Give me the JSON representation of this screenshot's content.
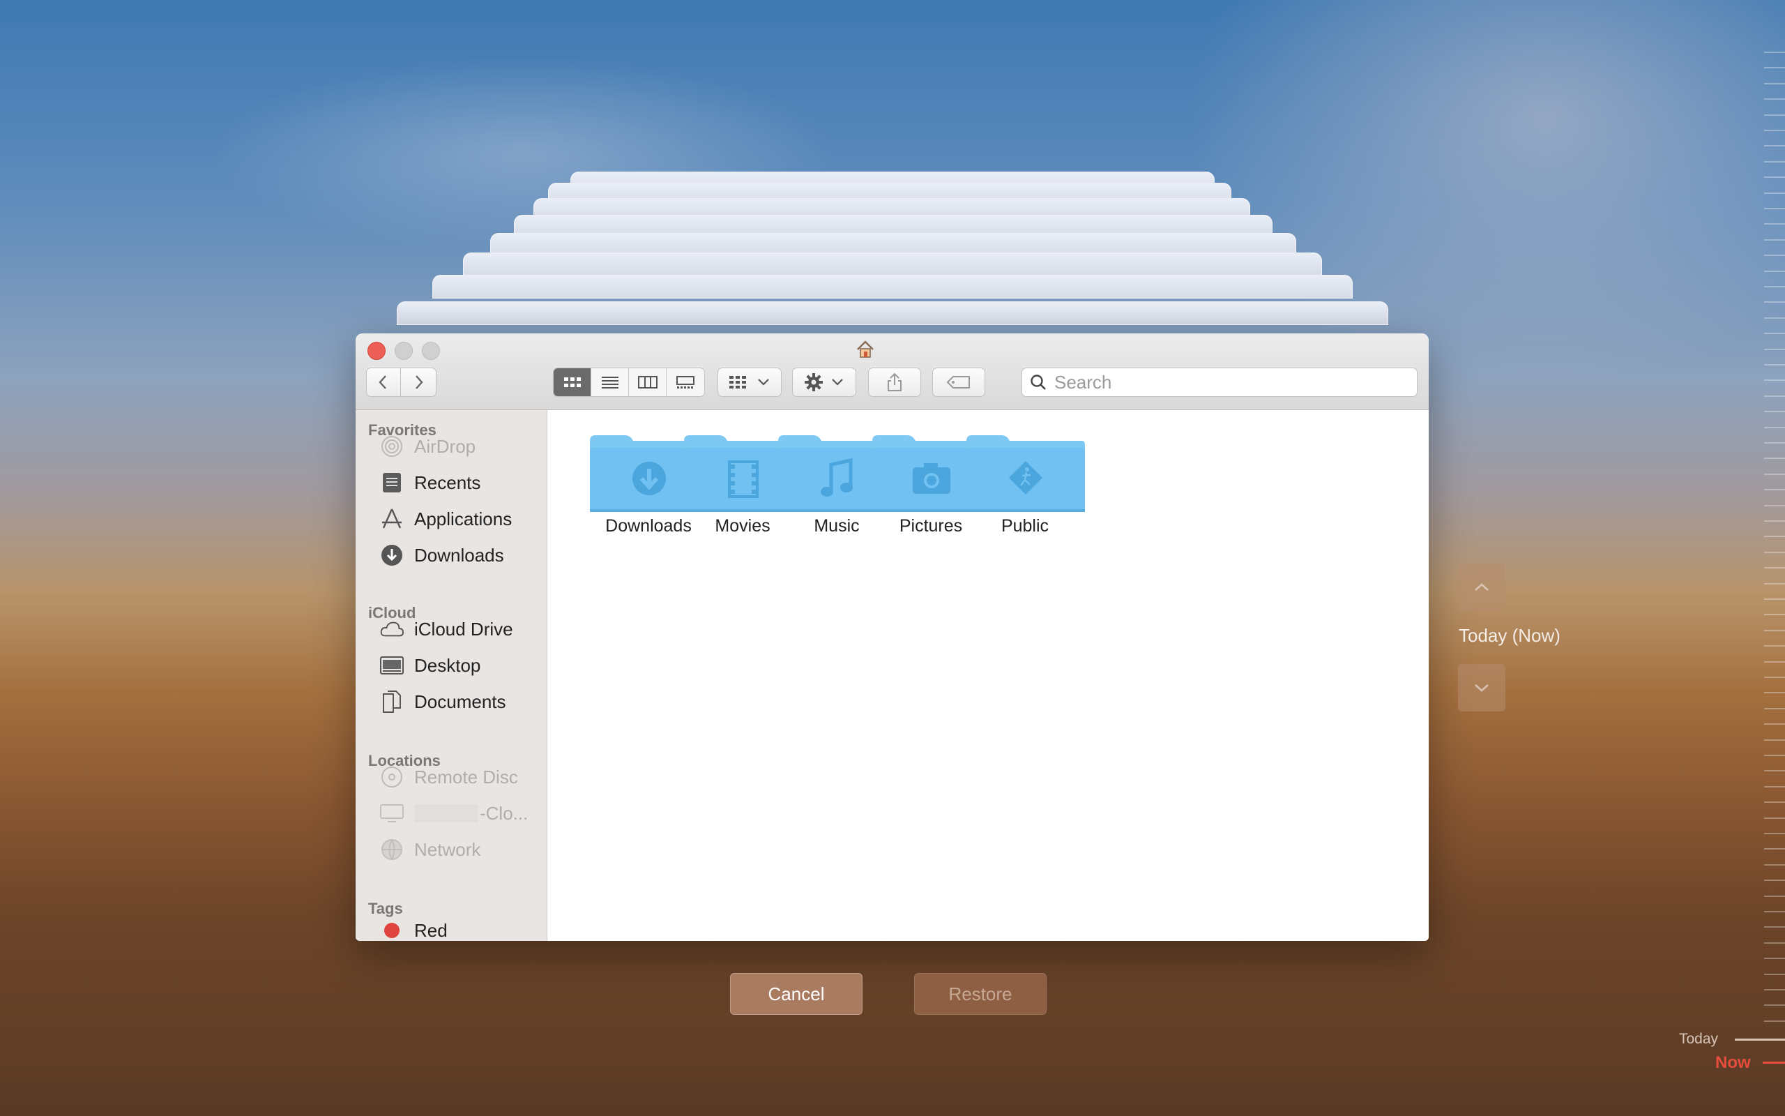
{
  "window": {
    "title_icon": "house-icon"
  },
  "toolbar": {
    "back_icon": "chevron-left-icon",
    "forward_icon": "chevron-right-icon",
    "view_modes": [
      "icon-view-icon",
      "list-view-icon",
      "column-view-icon",
      "gallery-view-icon"
    ],
    "active_view": "icon-view-icon",
    "group_icon": "group-by-icon",
    "action_icon": "gear-icon",
    "share_icon": "share-icon",
    "tag_icon": "tag-icon",
    "search_placeholder": "Search"
  },
  "sidebar": {
    "favorites_title": "Favorites",
    "favorites": [
      {
        "label": "AirDrop",
        "icon": "airdrop-icon",
        "dim": true
      },
      {
        "label": "Recents",
        "icon": "recents-icon",
        "dim": false
      },
      {
        "label": "Applications",
        "icon": "applications-icon",
        "dim": false
      },
      {
        "label": "Downloads",
        "icon": "downloads-icon",
        "dim": false
      }
    ],
    "icloud_title": "iCloud",
    "icloud": [
      {
        "label": "iCloud Drive",
        "icon": "cloud-icon"
      },
      {
        "label": "Desktop",
        "icon": "desktop-icon"
      },
      {
        "label": "Documents",
        "icon": "documents-icon"
      }
    ],
    "locations_title": "Locations",
    "locations": [
      {
        "label": "Remote Disc",
        "icon": "disc-icon",
        "dim": true
      },
      {
        "label": "-Clo...",
        "icon": "computer-icon",
        "dim": true
      },
      {
        "label": "Network",
        "icon": "network-icon",
        "dim": true
      }
    ],
    "tags_title": "Tags",
    "tags": [
      {
        "label": "Red",
        "color": "#e0443e"
      }
    ]
  },
  "folders": [
    {
      "label": "Downloads",
      "icon": "download-arrow-icon"
    },
    {
      "label": "Movies",
      "icon": "film-icon"
    },
    {
      "label": "Music",
      "icon": "music-note-icon"
    },
    {
      "label": "Pictures",
      "icon": "camera-icon"
    },
    {
      "label": "Public",
      "icon": "public-icon"
    }
  ],
  "buttons": {
    "cancel": "Cancel",
    "restore": "Restore"
  },
  "timemachine": {
    "current": "Today (Now)",
    "up_icon": "chevron-up-icon",
    "down_icon": "chevron-down-icon",
    "timeline_today": "Today",
    "timeline_now": "Now"
  },
  "colors": {
    "close": "#ec5f57",
    "traffic_inactive": "#cfcfcf",
    "folder": "#71c2f2",
    "folder_glyph": "#4aa6dd",
    "now": "#e74c3c"
  }
}
